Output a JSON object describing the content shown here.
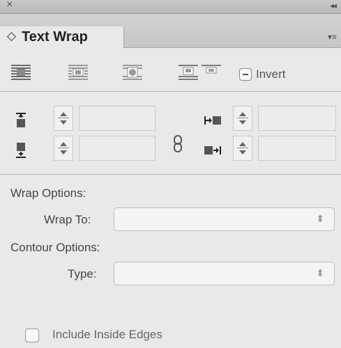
{
  "panel": {
    "close_icon": "close-icon",
    "collapse_icon": "collapse-panel-icon",
    "close_glyph": "×",
    "collapse_glyph": "◂◂",
    "tab_arrows_glyph": "◇",
    "tab_title": "Text Wrap",
    "menu_glyph": "▾≡"
  },
  "wrap_modes": [
    {
      "name": "no-text-wrap"
    },
    {
      "name": "wrap-around-bounding-box"
    },
    {
      "name": "wrap-around-object-shape"
    },
    {
      "name": "jump-object"
    },
    {
      "name": "jump-to-next-column"
    }
  ],
  "invert": {
    "label": "Invert",
    "checked": false
  },
  "offsets": {
    "top": "",
    "bottom": "",
    "left": "",
    "right": "",
    "linked_icon": "chain-link-icon"
  },
  "wrap_options": {
    "section_label": "Wrap Options:",
    "wrap_to_label": "Wrap To:",
    "wrap_to_value": ""
  },
  "contour_options": {
    "section_label": "Contour Options:",
    "type_label": "Type:",
    "type_value": ""
  },
  "include_inside_edges": {
    "label": "Include Inside Edges",
    "checked": false
  }
}
